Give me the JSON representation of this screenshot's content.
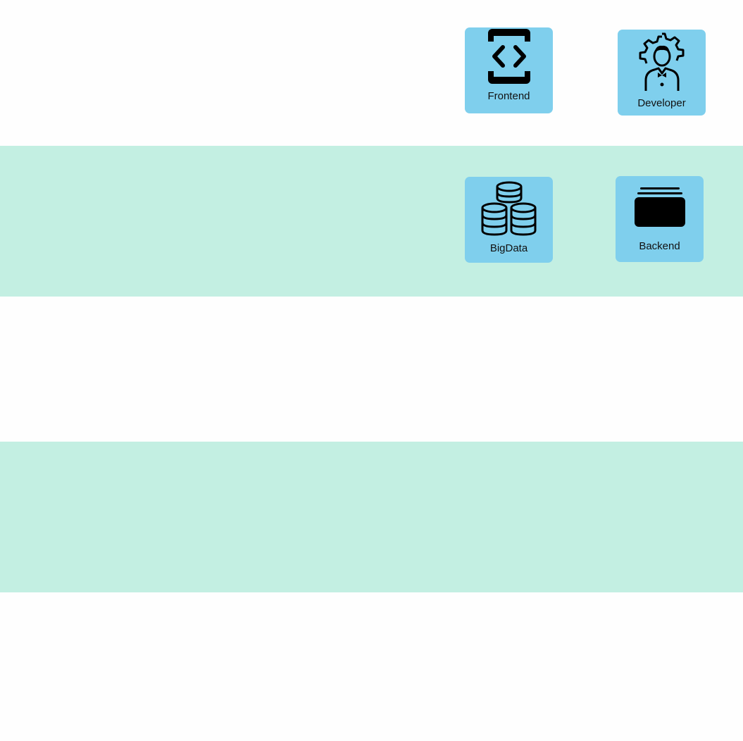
{
  "canvas": {
    "background_color": "#fefefe",
    "band_color": "#c3efe2",
    "tile_color": "#7fcfed",
    "icon_color": "#000000"
  },
  "tiles": [
    {
      "label": "Frontend",
      "icon": "frontend-code-brackets-icon"
    },
    {
      "label": "Developer",
      "icon": "developer-gear-person-icon"
    },
    {
      "label": "BigData",
      "icon": "bigdata-database-stack-icon"
    },
    {
      "label": "Backend",
      "icon": "backend-server-stack-icon"
    }
  ]
}
